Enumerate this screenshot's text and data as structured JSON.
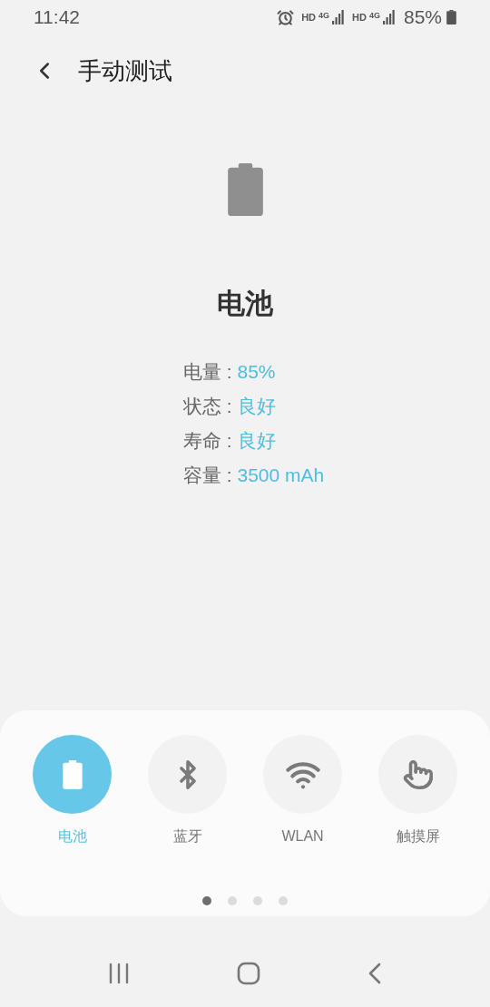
{
  "status_bar": {
    "time": "11:42",
    "sims": [
      {
        "hd": "HD",
        "tech": "4G"
      },
      {
        "hd": "HD",
        "tech": "4G"
      }
    ],
    "battery": "85%"
  },
  "header": {
    "title": "手动测试"
  },
  "battery_info": {
    "title": "电池",
    "rows": [
      {
        "label": "电量 : ",
        "value": "85%"
      },
      {
        "label": "状态 : ",
        "value": "良好"
      },
      {
        "label": "寿命 : ",
        "value": "良好"
      },
      {
        "label": "容量 : ",
        "value": "3500 mAh"
      }
    ]
  },
  "tests": [
    {
      "kind": "battery",
      "label": "电池",
      "selected": true
    },
    {
      "kind": "bluetooth",
      "label": "蓝牙",
      "selected": false
    },
    {
      "kind": "wifi",
      "label": "WLAN",
      "selected": false
    },
    {
      "kind": "touch",
      "label": "触摸屏",
      "selected": false
    }
  ],
  "pages": [
    {
      "selected": true
    },
    {
      "selected": false
    },
    {
      "selected": false
    },
    {
      "selected": false
    }
  ]
}
